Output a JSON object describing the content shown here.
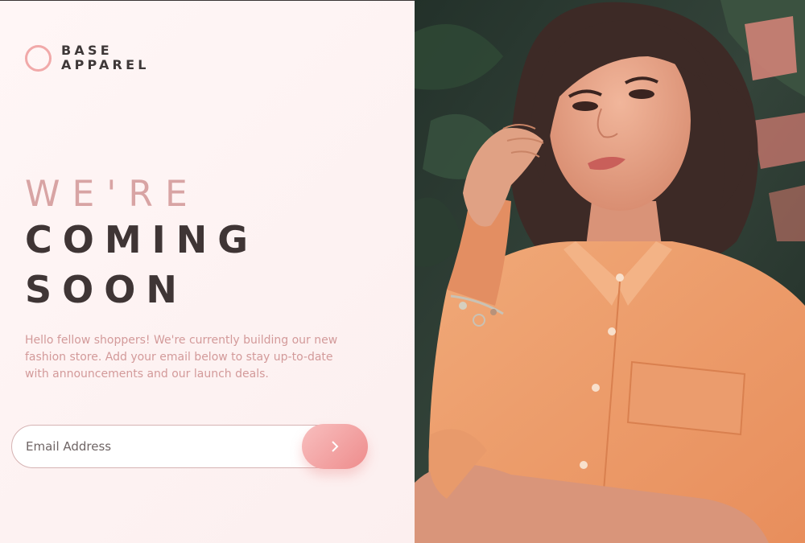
{
  "brand": {
    "line1": "BASE",
    "line2": "APPAREL"
  },
  "hero": {
    "line1": "WE'RE",
    "line2": "COMING",
    "line3": "SOON",
    "description": "Hello fellow shoppers! We're currently building our new fashion store. Add your email below to stay up-to-date with announcements and our launch deals."
  },
  "form": {
    "email_placeholder": "Email Address",
    "submit_icon": "chevron-right-icon"
  },
  "photo": {
    "subject": "hero-photo"
  },
  "colors": {
    "accent": "#f1a9a9",
    "button_start": "#f8bfbf",
    "button_end": "#ee8c8c",
    "heading_dark": "#3f3535",
    "heading_light": "#d8a4a4",
    "body_text": "#d39a9a",
    "background": "#fdf2f2"
  }
}
